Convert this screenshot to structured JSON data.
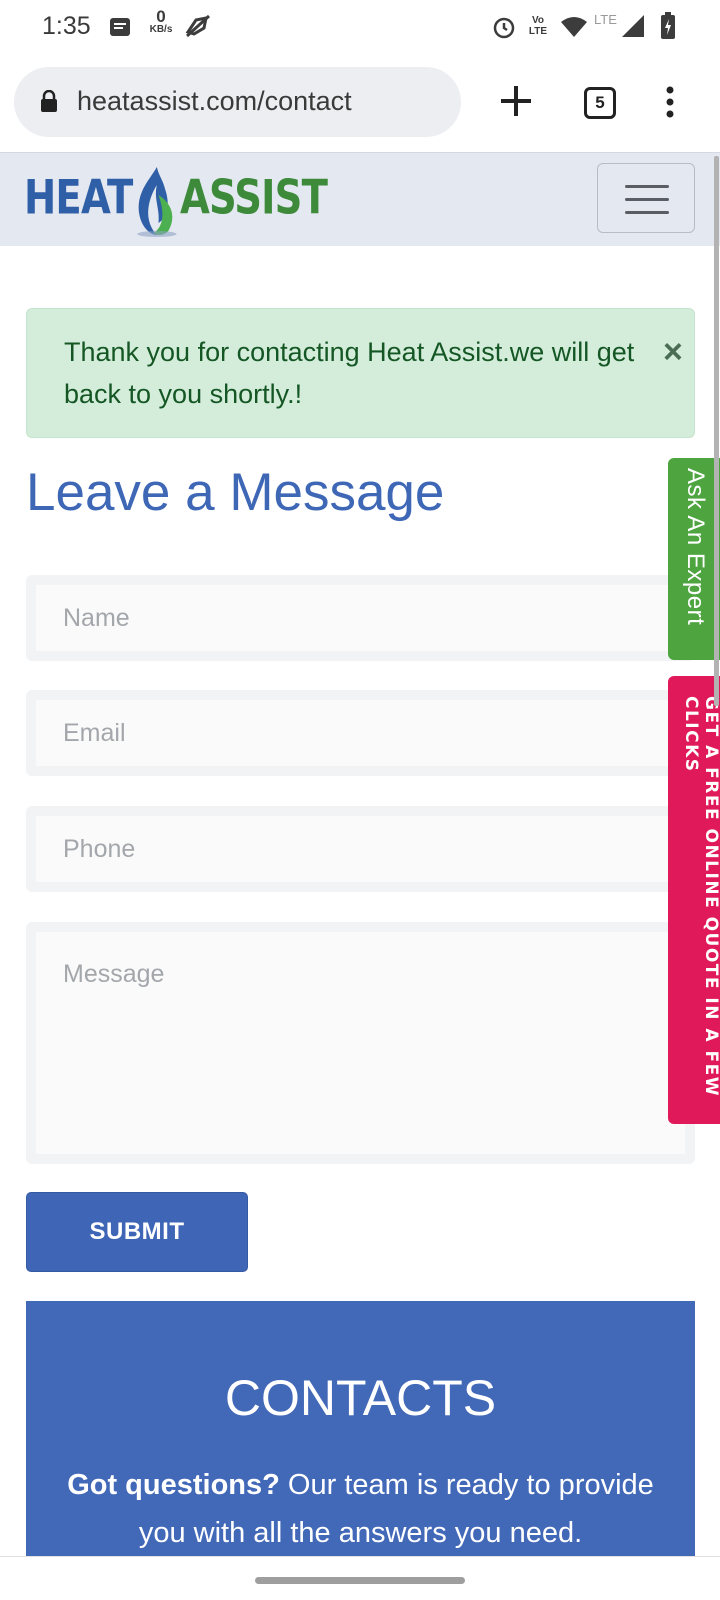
{
  "status_bar": {
    "time": "1:35",
    "net_speed_value": "0",
    "net_speed_unit": "KB/s",
    "volte": "Vo LTE",
    "lte": "LTE"
  },
  "browser": {
    "url": "heatassist.com/contact",
    "tab_count": "5"
  },
  "site": {
    "logo_left": "HEAT",
    "logo_right": "ASSIST"
  },
  "alert": {
    "message": "Thank you for contacting Heat Assist.we will get back to you shortly.!",
    "close": "×"
  },
  "form": {
    "heading": "Leave a Message",
    "name_placeholder": "Name",
    "email_placeholder": "Email",
    "phone_placeholder": "Phone",
    "message_placeholder": "Message",
    "submit_label": "SUBMIT"
  },
  "contacts": {
    "title": "CONTACTS",
    "lead": "Got questions?",
    "body": " Our team is ready to provide you with all the answers you need."
  },
  "side_tabs": {
    "expert": "Ask An Expert",
    "quote": "GET A FREE ONLINE QUOTE IN A FEW CLICKS"
  },
  "colors": {
    "brand_blue": "#3e67b6",
    "brand_green": "#3c8a3a",
    "alert_bg": "#d4eddb",
    "alert_text": "#155724",
    "expert_tab": "#4ea540",
    "quote_tab": "#e0195a"
  },
  "icons": [
    "notification-icon",
    "no-sim-icon",
    "alarm-icon",
    "wifi-icon",
    "signal-icon",
    "battery-icon",
    "lock-icon",
    "plus-icon",
    "tabs-icon",
    "more-vert-icon",
    "flame-icon",
    "hamburger-icon",
    "close-icon"
  ]
}
